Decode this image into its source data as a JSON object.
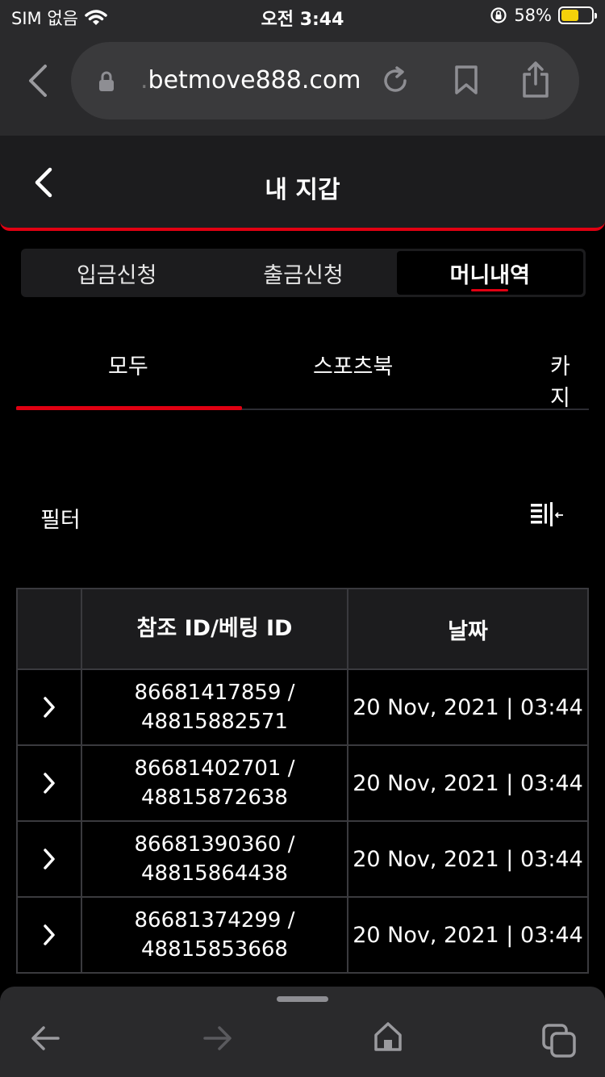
{
  "status_bar": {
    "carrier": "SIM 없음",
    "time": "오전 3:44",
    "battery_percent": "58%",
    "battery_level": 0.58,
    "battery_color": "#f5d20a"
  },
  "browser": {
    "url_faded": ".",
    "url": "betmove888.com",
    "icons": [
      "back-chevron-icon",
      "lock-icon",
      "reload-icon",
      "bookmark-icon",
      "share-icon"
    ]
  },
  "header": {
    "title": "내 지갑",
    "accent_color": "#e00012"
  },
  "wallet_tabs": [
    {
      "label": "입금신청",
      "active": false
    },
    {
      "label": "출금신청",
      "active": false
    },
    {
      "label": "머니내역",
      "active": true
    }
  ],
  "sub_tabs": [
    {
      "label": "모두",
      "active": true
    },
    {
      "label": "스포츠북",
      "active": false
    },
    {
      "label": "카지",
      "active": false
    }
  ],
  "filter": {
    "label": "필터",
    "icon": "filter-list-icon"
  },
  "table": {
    "headers": [
      "",
      "참조 ID/베팅 ID",
      "날짜"
    ],
    "rows": [
      {
        "ref_id": "86681417859 /",
        "bet_id": "48815882571",
        "date": "20 Nov, 2021 | 03:44"
      },
      {
        "ref_id": "86681402701 /",
        "bet_id": "48815872638",
        "date": "20 Nov, 2021 | 03:44"
      },
      {
        "ref_id": "86681390360 /",
        "bet_id": "48815864438",
        "date": "20 Nov, 2021 | 03:44"
      },
      {
        "ref_id": "86681374299 /",
        "bet_id": "48815853668",
        "date": "20 Nov, 2021 | 03:44"
      }
    ]
  },
  "toolbar": {
    "icons": [
      "back-arrow-icon",
      "forward-arrow-icon",
      "home-icon",
      "tabs-icon"
    ]
  }
}
